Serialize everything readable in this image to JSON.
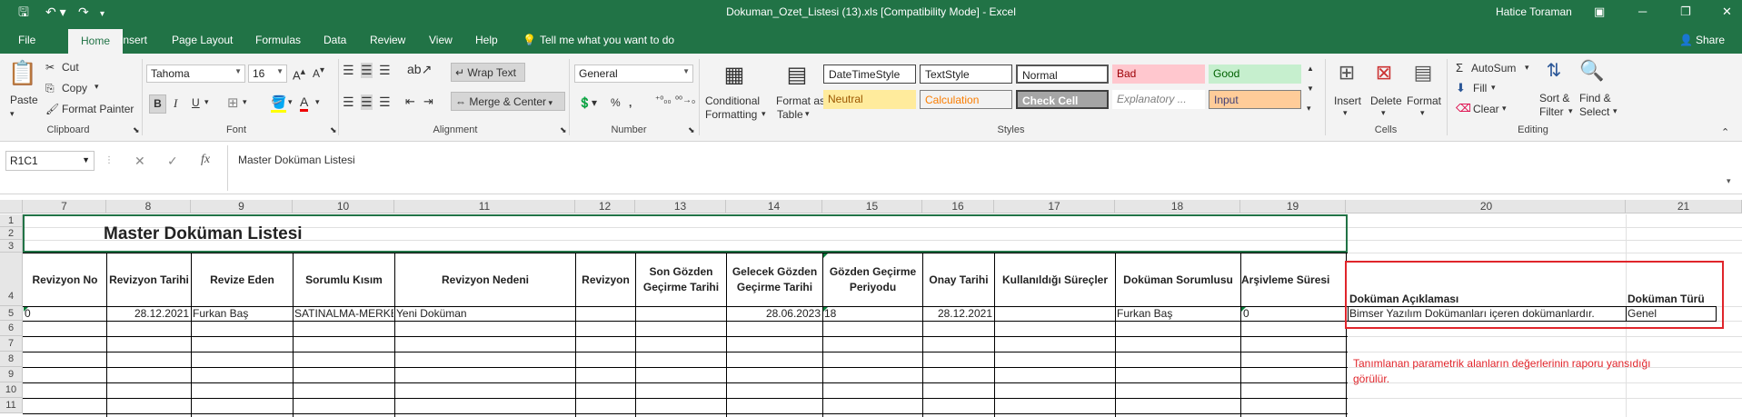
{
  "window": {
    "title": "Dokuman_Ozet_Listesi (13).xls  [Compatibility Mode]  -  Excel",
    "user": "Hatice Toraman",
    "quick_access": {
      "save_icon": "save-icon",
      "undo_icon": "undo-icon",
      "redo_icon": "redo-icon"
    }
  },
  "menu": {
    "tabs": [
      "File",
      "Home",
      "Insert",
      "Page Layout",
      "Formulas",
      "Data",
      "Review",
      "View",
      "Help"
    ],
    "tell_me": "Tell me what you want to do",
    "share": "Share"
  },
  "ribbon": {
    "clipboard": {
      "paste": "Paste",
      "cut": "Cut",
      "copy": "Copy",
      "format_painter": "Format Painter",
      "group": "Clipboard"
    },
    "font": {
      "name": "Tahoma",
      "size": "16",
      "group": "Font"
    },
    "alignment": {
      "wrap_text": "Wrap Text",
      "merge_center": "Merge & Center",
      "group": "Alignment"
    },
    "number": {
      "format": "General",
      "group": "Number"
    },
    "styles": {
      "conditional_1": "Conditional",
      "conditional_2": "Formatting",
      "format_table_1": "Format as",
      "format_table_2": "Table",
      "cells": [
        "DateTimeStyle",
        "TextStyle",
        "Normal",
        "Bad",
        "Good",
        "Neutral",
        "Calculation",
        "Check Cell",
        "Explanatory ...",
        "Input"
      ],
      "group": "Styles"
    },
    "cells": {
      "insert": "Insert",
      "delete": "Delete",
      "format": "Format",
      "group": "Cells"
    },
    "editing": {
      "autosum": "AutoSum",
      "fill": "Fill",
      "clear": "Clear",
      "sort_1": "Sort &",
      "sort_2": "Filter",
      "find_1": "Find &",
      "find_2": "Select",
      "group": "Editing"
    }
  },
  "formula_bar": {
    "name_box": "R1C1",
    "fx": "fx",
    "content": "Master Doküman Listesi"
  },
  "sheet": {
    "columns": [
      "7",
      "8",
      "9",
      "10",
      "11",
      "12",
      "13",
      "14",
      "15",
      "16",
      "17",
      "18",
      "19",
      "20",
      "21"
    ],
    "rows": [
      "1",
      "2",
      "3",
      "4",
      "5",
      "6",
      "7",
      "8",
      "9",
      "10",
      "11"
    ],
    "title": "Master Doküman Listesi",
    "headers": [
      "Revizyon No",
      "Revizyon Tarihi",
      "Revize Eden",
      "Sorumlu Kısım",
      "Revizyon Nedeni",
      "Revizyon",
      "Son Gözden Geçirme Tarihi",
      "Gelecek Gözden Geçirme Tarihi",
      "Gözden Geçirme Periyodu",
      "Onay Tarihi",
      "Kullanıldığı Süreçler",
      "Doküman Sorumlusu",
      "Arşivleme Süresi"
    ],
    "row5": [
      "0",
      "28.12.2021",
      "Furkan Baş",
      "SATINALMA-MERKEZ",
      "Yeni Doküman",
      "",
      "",
      "28.06.2023",
      "18",
      "28.12.2021",
      "",
      "Furkan Baş",
      "0"
    ],
    "extra_headers": [
      "Doküman Açıklaması",
      "Doküman Türü"
    ],
    "extra_row5": [
      "Bimser Yazılım Dokümanları içeren dokümanlardır.",
      "Genel"
    ],
    "annotation": "Tanımlanan parametrik alanların değerlerinin raporu yansıdığı görülür.",
    "highlight_color": "#e0252b"
  }
}
